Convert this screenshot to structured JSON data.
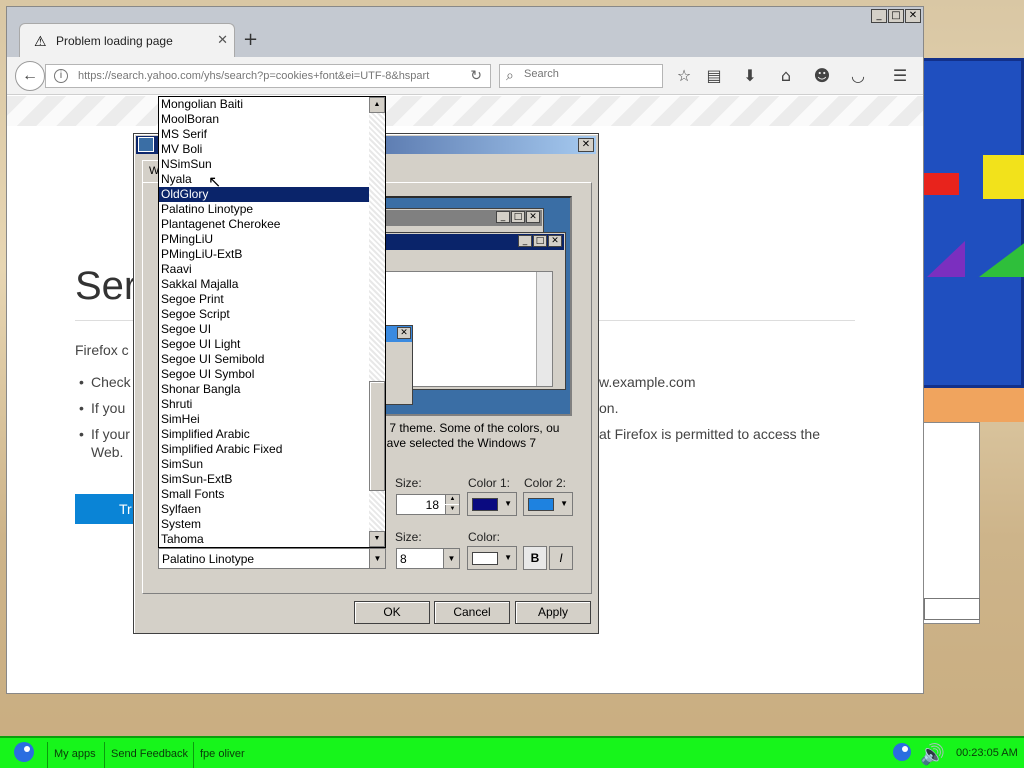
{
  "browser": {
    "tab_title": "Problem loading page",
    "url": "https://search.yahoo.com/yhs/search?p=cookies+font&ei=UTF-8&hspart",
    "search_placeholder": "Search"
  },
  "error_page": {
    "title": "Ser",
    "intro": "Firefox c",
    "bullets": [
      "Check",
      "If you",
      "If your"
    ],
    "bullet_cont_web": "Web.",
    "right_1": "w.example.com",
    "right_2": "on.",
    "right_3": "at Firefox is permitted to access the",
    "try_button": "Tr"
  },
  "dialog": {
    "tab_label": "W",
    "description": "s 7 theme. Some of the colors, ou have selected the Windows 7",
    "size_label": "Size:",
    "size_value": "18",
    "color1_label": "Color 1:",
    "color2_label": "Color 2:",
    "font_size_label": "Size:",
    "font_size_value": "8",
    "font_color_label": "Color:",
    "bold_label": "B",
    "italic_label": "I",
    "ok_label": "OK",
    "cancel_label": "Cancel",
    "apply_label": "Apply",
    "color1": "#0a0a80",
    "color2": "#1e82e0",
    "font_color": "#ffffff",
    "selected_font": "Palatino Linotype"
  },
  "font_list": {
    "items": [
      "Mongolian Baiti",
      "MoolBoran",
      "MS Serif",
      "MV Boli",
      "NSimSun",
      "Nyala",
      "OldGlory",
      "Palatino Linotype",
      "Plantagenet Cherokee",
      "PMingLiU",
      "PMingLiU-ExtB",
      "Raavi",
      "Sakkal Majalla",
      "Segoe Print",
      "Segoe Script",
      "Segoe UI",
      "Segoe UI Light",
      "Segoe UI Semibold",
      "Segoe UI Symbol",
      "Shonar Bangla",
      "Shruti",
      "SimHei",
      "Simplified Arabic",
      "Simplified Arabic Fixed",
      "SimSun",
      "SimSun-ExtB",
      "Small Fonts",
      "Sylfaen",
      "System",
      "Tahoma"
    ],
    "highlighted_index": 6
  },
  "taskbar": {
    "items": [
      "My apps",
      "Send Feedback",
      "fpe oliver"
    ],
    "clock": "00:23:05 AM"
  }
}
